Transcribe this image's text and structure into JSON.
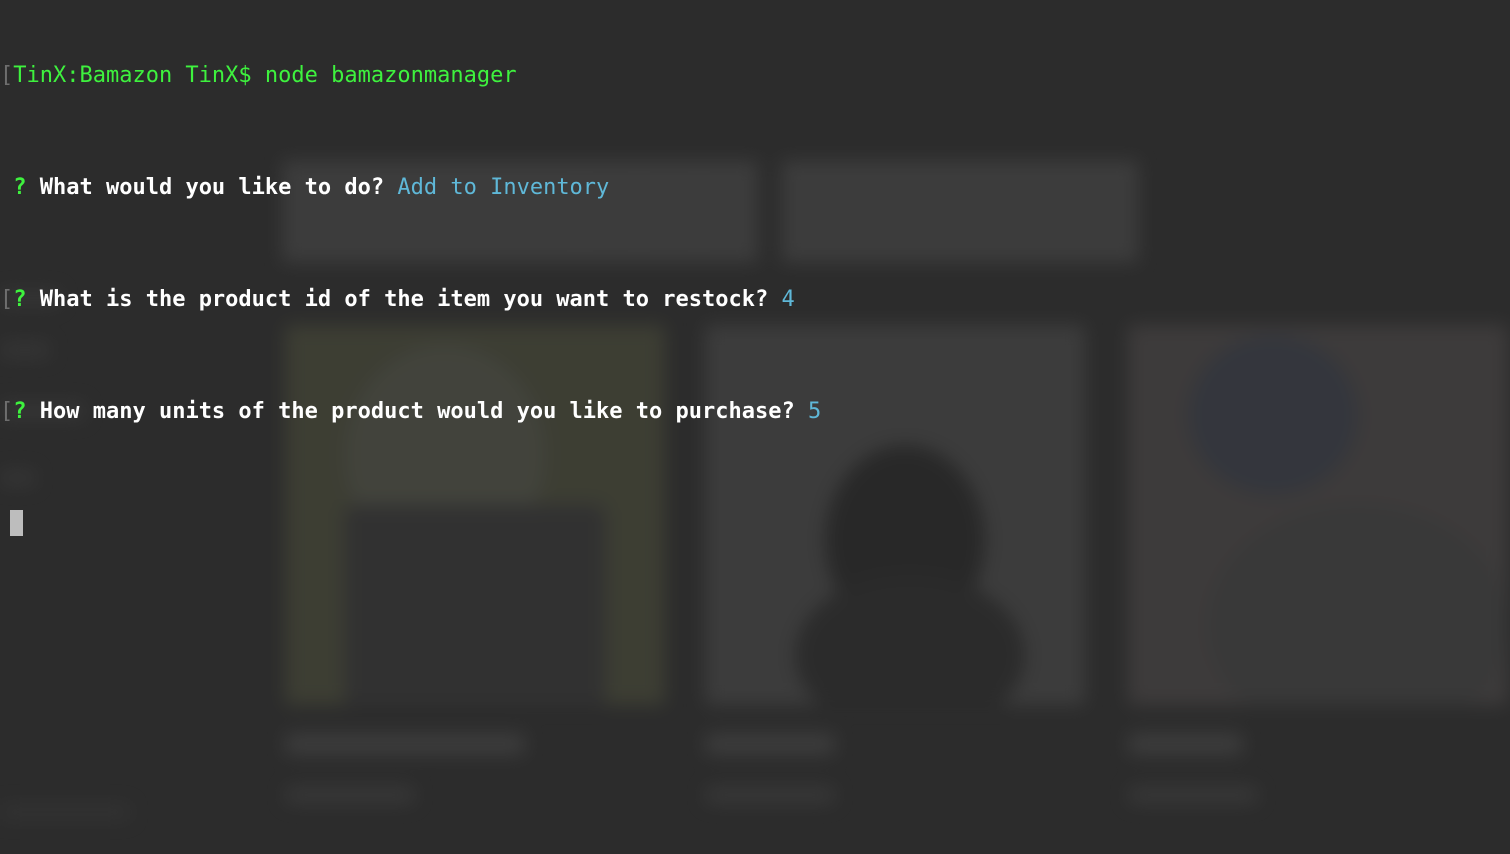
{
  "terminal": {
    "prompt": {
      "bracket": "[",
      "host": "TinX:Bamazon TinX$",
      "command": "node bamazonmanager"
    },
    "lines": [
      {
        "bracket": " ",
        "marker": "?",
        "question": "What would you like to do?",
        "answer": "Add to Inventory"
      },
      {
        "bracket": "[",
        "marker": "?",
        "question": "What is the product id of the item you want to restock?",
        "answer": "4"
      },
      {
        "bracket": "[",
        "marker": "?",
        "question": "How many units of the product would you like to purchase?",
        "answer": "5"
      }
    ]
  },
  "colors": {
    "prompt_green": "#3ef23e",
    "answer_cyan": "#5fb8d8",
    "background": "#2c2c2c",
    "cursor": "#bdbdbd"
  }
}
